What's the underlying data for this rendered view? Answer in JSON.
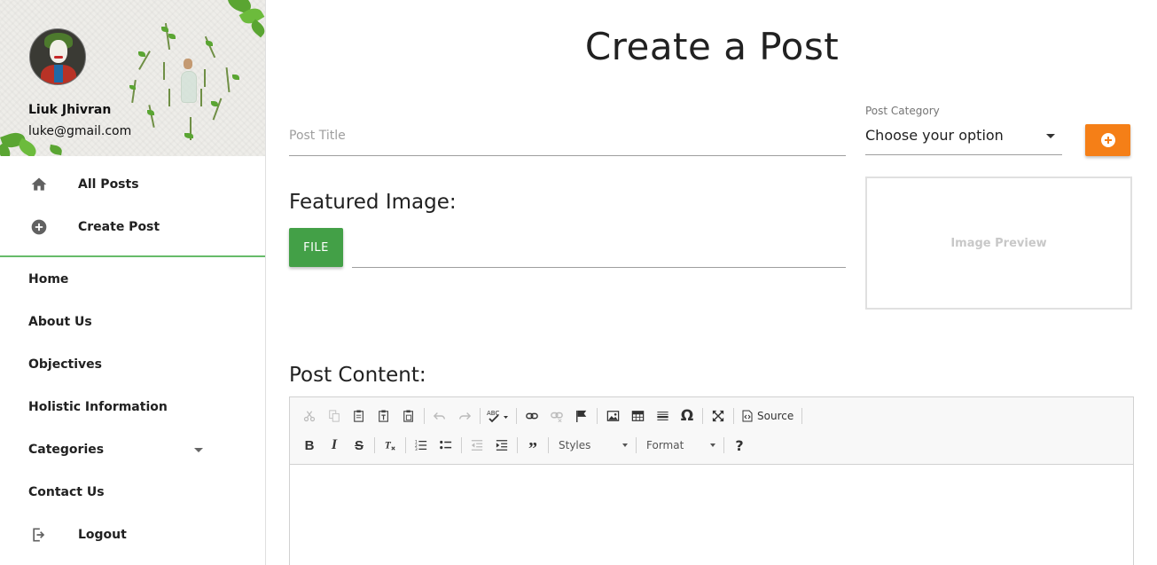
{
  "sidebar": {
    "user": {
      "name": "Liuk Jhivran",
      "email": "luke@gmail.com"
    },
    "primary_items": [
      {
        "label": "All Posts",
        "icon": "home-icon"
      },
      {
        "label": "Create Post",
        "icon": "add-circle-icon"
      }
    ],
    "secondary_items": [
      {
        "label": "Home"
      },
      {
        "label": "About Us"
      },
      {
        "label": "Objectives"
      },
      {
        "label": "Holistic Information"
      },
      {
        "label": "Categories",
        "icon": "caret-down-icon"
      },
      {
        "label": "Contact Us"
      }
    ],
    "logout": {
      "label": "Logout",
      "icon": "logout-icon"
    },
    "accent_color": "#66bb6a"
  },
  "main": {
    "page_title": "Create a Post",
    "post_title": {
      "placeholder": "Post Title",
      "value": ""
    },
    "category": {
      "label": "Post Category",
      "selected": "Choose your option"
    },
    "add_category_button": {
      "icon": "add-circle-icon",
      "color": "#f57f17"
    },
    "featured_image": {
      "heading": "Featured Image:",
      "file_button": "FILE",
      "file_path": "",
      "color": "#43a047"
    },
    "image_preview": {
      "label": "Image Preview"
    },
    "post_content": {
      "heading": "Post Content:"
    }
  },
  "editor": {
    "row1": [
      {
        "icon": "cut-icon",
        "enabled": false
      },
      {
        "icon": "copy-icon",
        "enabled": false
      },
      {
        "icon": "paste-icon",
        "enabled": true
      },
      {
        "icon": "paste-text-icon",
        "enabled": true
      },
      {
        "icon": "paste-word-icon",
        "enabled": true
      },
      {
        "icon": "undo-icon",
        "enabled": false
      },
      {
        "icon": "redo-icon",
        "enabled": false
      },
      {
        "icon": "spellcheck-icon",
        "enabled": true
      },
      {
        "icon": "link-icon",
        "enabled": true
      },
      {
        "icon": "unlink-icon",
        "enabled": false
      },
      {
        "icon": "anchor-icon",
        "enabled": true
      },
      {
        "icon": "image-icon",
        "enabled": true
      },
      {
        "icon": "table-icon",
        "enabled": true
      },
      {
        "icon": "horizontal-rule-icon",
        "enabled": true
      },
      {
        "icon": "special-char-icon",
        "enabled": true
      },
      {
        "icon": "maximize-icon",
        "enabled": true
      },
      {
        "icon": "source-icon",
        "enabled": true
      }
    ],
    "source_label": "Source",
    "styles_label": "Styles",
    "format_label": "Format",
    "bold_label": "B",
    "italic_label": "I",
    "strike_label": "S",
    "help_label": "?"
  }
}
